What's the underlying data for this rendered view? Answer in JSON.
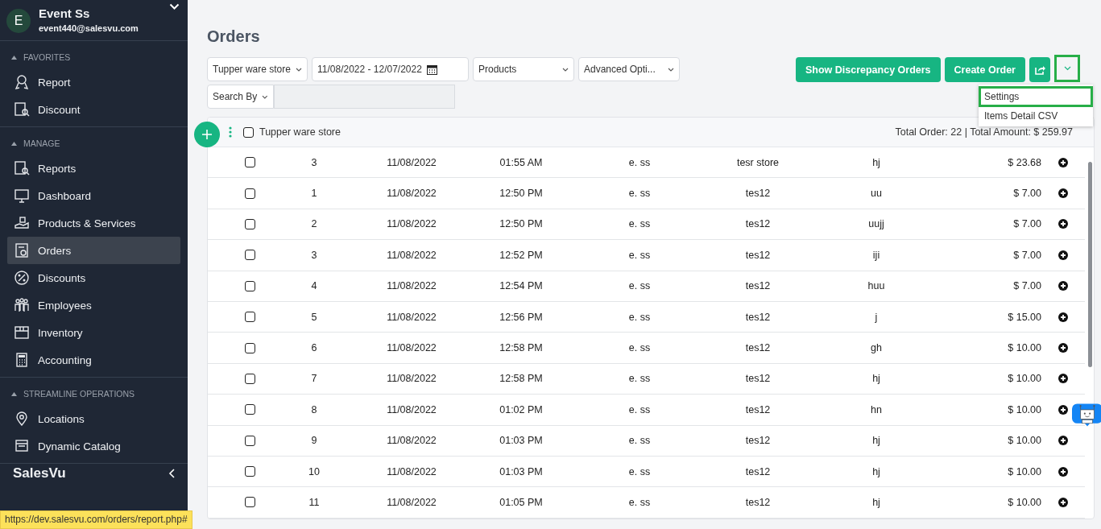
{
  "user": {
    "initial": "E",
    "name": "Event Ss",
    "email": "event440@salesvu.com"
  },
  "sidebar": {
    "sections": [
      {
        "title": "FAVORITES",
        "expanded": true,
        "items": [
          {
            "label": "Report",
            "selected": false
          },
          {
            "label": "Discount",
            "selected": false
          }
        ]
      },
      {
        "title": "MANAGE",
        "expanded": true,
        "items": [
          {
            "label": "Reports",
            "selected": false
          },
          {
            "label": "Dashboard",
            "selected": false
          },
          {
            "label": "Products & Services",
            "selected": false
          },
          {
            "label": "Orders",
            "selected": true
          },
          {
            "label": "Discounts",
            "selected": false
          },
          {
            "label": "Employees",
            "selected": false
          },
          {
            "label": "Inventory",
            "selected": false
          },
          {
            "label": "Accounting",
            "selected": false
          }
        ]
      },
      {
        "title": "STREAMLINE OPERATIONS",
        "expanded": true,
        "items": [
          {
            "label": "Locations",
            "selected": false
          },
          {
            "label": "Dynamic Catalog",
            "selected": false
          }
        ]
      }
    ],
    "brand": "SalesVu"
  },
  "page_title": "Orders",
  "filters": {
    "store": "Tupper ware store",
    "date_range": "11/08/2022 - 12/07/2022",
    "products": "Products",
    "advanced": "Advanced Opti...",
    "search_by": "Search By"
  },
  "buttons": [
    {
      "label": "Show Discrepancy Orders"
    },
    {
      "label": "Create Order"
    }
  ],
  "menu": {
    "expanded": true,
    "items": [
      {
        "label": "Settings",
        "highlighted": true
      },
      {
        "label": "Items Detail CSV",
        "highlighted": false
      }
    ]
  },
  "table": {
    "store": "Tupper ware store",
    "checked": false,
    "totals": "Total Order: 22 | Total Amount: $ 259.97",
    "rows": [
      {
        "number": "3",
        "date": "11/08/2022",
        "time": "01:55 AM",
        "employee": "e. ss",
        "location": "tesr store",
        "note": "hj",
        "amount": "$ 23.68",
        "checked": false
      },
      {
        "number": "1",
        "date": "11/08/2022",
        "time": "12:50 PM",
        "employee": "e. ss",
        "location": "tes12",
        "note": "uu",
        "amount": "$ 7.00",
        "checked": false
      },
      {
        "number": "2",
        "date": "11/08/2022",
        "time": "12:50 PM",
        "employee": "e. ss",
        "location": "tes12",
        "note": "uujj",
        "amount": "$ 7.00",
        "checked": false
      },
      {
        "number": "3",
        "date": "11/08/2022",
        "time": "12:52 PM",
        "employee": "e. ss",
        "location": "tes12",
        "note": "iji",
        "amount": "$ 7.00",
        "checked": false
      },
      {
        "number": "4",
        "date": "11/08/2022",
        "time": "12:54 PM",
        "employee": "e. ss",
        "location": "tes12",
        "note": "huu",
        "amount": "$ 7.00",
        "checked": false
      },
      {
        "number": "5",
        "date": "11/08/2022",
        "time": "12:56 PM",
        "employee": "e. ss",
        "location": "tes12",
        "note": "j",
        "amount": "$ 15.00",
        "checked": false
      },
      {
        "number": "6",
        "date": "11/08/2022",
        "time": "12:58 PM",
        "employee": "e. ss",
        "location": "tes12",
        "note": "gh",
        "amount": "$ 10.00",
        "checked": false
      },
      {
        "number": "7",
        "date": "11/08/2022",
        "time": "12:58 PM",
        "employee": "e. ss",
        "location": "tes12",
        "note": "hj",
        "amount": "$ 10.00",
        "checked": false
      },
      {
        "number": "8",
        "date": "11/08/2022",
        "time": "01:02 PM",
        "employee": "e. ss",
        "location": "tes12",
        "note": "hn",
        "amount": "$ 10.00",
        "checked": false
      },
      {
        "number": "9",
        "date": "11/08/2022",
        "time": "01:03 PM",
        "employee": "e. ss",
        "location": "tes12",
        "note": "hj",
        "amount": "$ 10.00",
        "checked": false
      },
      {
        "number": "10",
        "date": "11/08/2022",
        "time": "01:03 PM",
        "employee": "e. ss",
        "location": "tes12",
        "note": "hj",
        "amount": "$ 10.00",
        "checked": false
      },
      {
        "number": "11",
        "date": "11/08/2022",
        "time": "01:05 PM",
        "employee": "e. ss",
        "location": "tes12",
        "note": "hj",
        "amount": "$ 10.00",
        "checked": false
      }
    ]
  },
  "status_url": "https://dev.salesvu.com/orders/report.php#"
}
